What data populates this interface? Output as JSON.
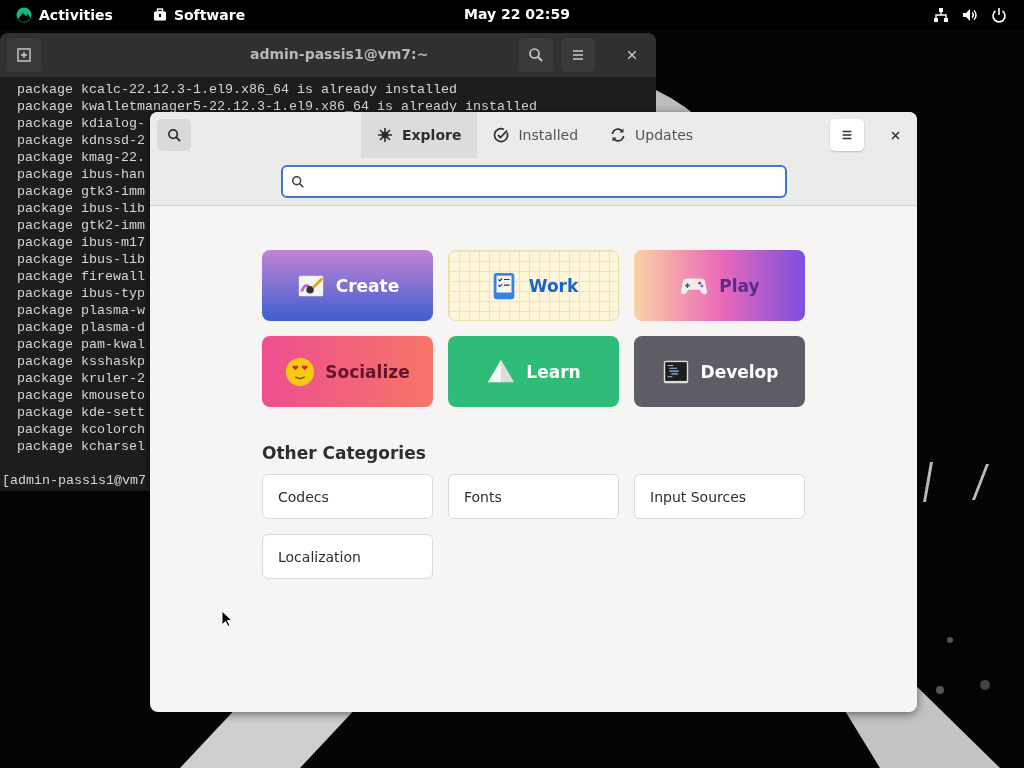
{
  "top_bar": {
    "activities": "Activities",
    "app_menu": "Software",
    "clock": "May 22  02:59"
  },
  "terminal": {
    "title": "admin-passis1@vm7:~",
    "lines": [
      "package kcalc-22.12.3-1.el9.x86_64 is already installed",
      "package kwalletmanager5-22.12.3-1.el9.x86_64 is already installed",
      "package kdialog-",
      "package kdnssd-2",
      "package kmag-22.",
      "package ibus-han",
      "package gtk3-imm",
      "package ibus-lib",
      "package gtk2-imm",
      "package ibus-m17",
      "package ibus-lib",
      "package firewall",
      "package ibus-typ",
      "package plasma-w",
      "package plasma-d",
      "package pam-kwal",
      "package ksshaskp",
      "package kruler-2",
      "package kmouseto",
      "package kde-sett",
      "package kcolorch",
      "package kcharsel"
    ],
    "prompt": "[admin-passis1@vm7"
  },
  "software": {
    "tabs": [
      {
        "label": "Explore",
        "kind": "explore",
        "selected": true
      },
      {
        "label": "Installed",
        "kind": "installed",
        "selected": false
      },
      {
        "label": "Updates",
        "kind": "updates",
        "selected": false
      }
    ],
    "featured": [
      {
        "label": "Create",
        "kind": "create"
      },
      {
        "label": "Work",
        "kind": "work"
      },
      {
        "label": "Play",
        "kind": "play"
      },
      {
        "label": "Socialize",
        "kind": "socialize"
      },
      {
        "label": "Learn",
        "kind": "learn"
      },
      {
        "label": "Develop",
        "kind": "develop"
      }
    ],
    "other_heading": "Other Categories",
    "other_categories": [
      "Codecs",
      "Fonts",
      "Input Sources",
      "Localization"
    ]
  }
}
